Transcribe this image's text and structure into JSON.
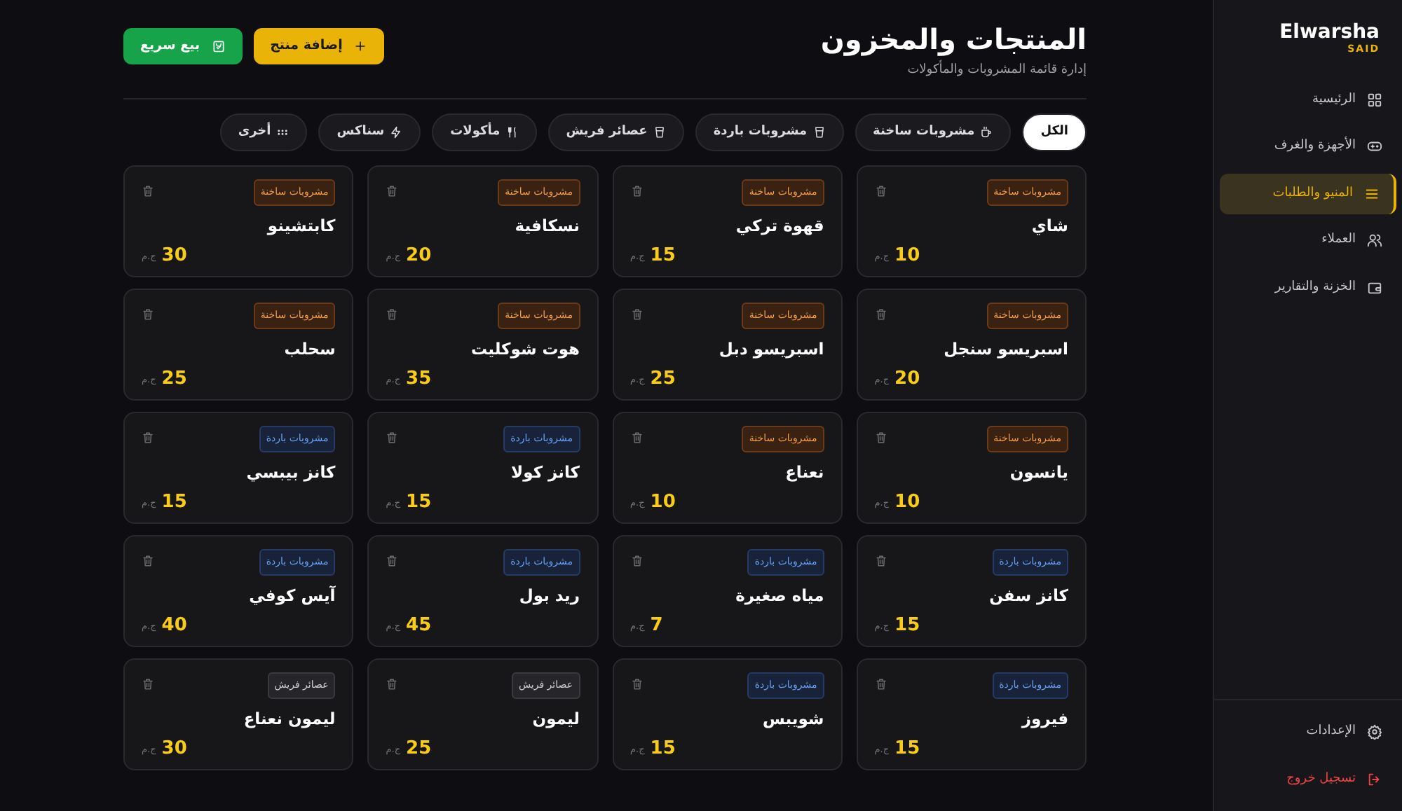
{
  "brand": {
    "name": "Elwarsha",
    "tag": "SAID"
  },
  "nav": [
    {
      "label": "الرئيسية",
      "selected": false
    },
    {
      "label": "الأجهزة والغرف",
      "selected": false
    },
    {
      "label": "المنيو والطلبات",
      "selected": true
    },
    {
      "label": "العملاء",
      "selected": false
    },
    {
      "label": "الخزنة والتقارير",
      "selected": false
    }
  ],
  "footer_nav": [
    {
      "label": "الإعدادات",
      "kind": "settings"
    },
    {
      "label": "تسجيل خروج",
      "kind": "logout"
    }
  ],
  "header": {
    "title": "المنتجات والمخزون",
    "subtitle": "إدارة قائمة المشروبات والمأكولات"
  },
  "actions": [
    {
      "label": "إضافة منتج",
      "kind": "add"
    },
    {
      "label": "بيع سريع",
      "kind": "sell"
    }
  ],
  "filters": [
    {
      "label": "الكل",
      "selected": true
    },
    {
      "label": "مشروبات ساخنة",
      "selected": false
    },
    {
      "label": "مشروبات باردة",
      "selected": false
    },
    {
      "label": "عصائر فريش",
      "selected": false
    },
    {
      "label": "مأكولات",
      "selected": false
    },
    {
      "label": "سناكس",
      "selected": false
    },
    {
      "label": "أخرى",
      "selected": false
    }
  ],
  "products": [
    {
      "name": "شاي",
      "price": "10",
      "currency": "ج.م",
      "category": "مشروبات ساخنة",
      "kind": "hot"
    },
    {
      "name": "قهوة تركي",
      "price": "15",
      "currency": "ج.م",
      "category": "مشروبات ساخنة",
      "kind": "hot"
    },
    {
      "name": "نسكافية",
      "price": "20",
      "currency": "ج.م",
      "category": "مشروبات ساخنة",
      "kind": "hot"
    },
    {
      "name": "كابتشينو",
      "price": "30",
      "currency": "ج.م",
      "category": "مشروبات ساخنة",
      "kind": "hot"
    },
    {
      "name": "اسبريسو سنجل",
      "price": "20",
      "currency": "ج.م",
      "category": "مشروبات ساخنة",
      "kind": "hot"
    },
    {
      "name": "اسبريسو دبل",
      "price": "25",
      "currency": "ج.م",
      "category": "مشروبات ساخنة",
      "kind": "hot"
    },
    {
      "name": "هوت شوكليت",
      "price": "35",
      "currency": "ج.م",
      "category": "مشروبات ساخنة",
      "kind": "hot"
    },
    {
      "name": "سحلب",
      "price": "25",
      "currency": "ج.م",
      "category": "مشروبات ساخنة",
      "kind": "hot"
    },
    {
      "name": "يانسون",
      "price": "10",
      "currency": "ج.م",
      "category": "مشروبات ساخنة",
      "kind": "hot"
    },
    {
      "name": "نعناع",
      "price": "10",
      "currency": "ج.م",
      "category": "مشروبات ساخنة",
      "kind": "hot"
    },
    {
      "name": "كانز كولا",
      "price": "15",
      "currency": "ج.م",
      "category": "مشروبات باردة",
      "kind": "cold"
    },
    {
      "name": "كانز بيبسي",
      "price": "15",
      "currency": "ج.م",
      "category": "مشروبات باردة",
      "kind": "cold"
    },
    {
      "name": "كانز سفن",
      "price": "15",
      "currency": "ج.م",
      "category": "مشروبات باردة",
      "kind": "cold"
    },
    {
      "name": "مياه صغيرة",
      "price": "7",
      "currency": "ج.م",
      "category": "مشروبات باردة",
      "kind": "cold"
    },
    {
      "name": "ريد بول",
      "price": "45",
      "currency": "ج.م",
      "category": "مشروبات باردة",
      "kind": "cold"
    },
    {
      "name": "آيس كوفي",
      "price": "40",
      "currency": "ج.م",
      "category": "مشروبات باردة",
      "kind": "cold"
    },
    {
      "name": "فيروز",
      "price": "15",
      "currency": "ج.م",
      "category": "مشروبات باردة",
      "kind": "cold"
    },
    {
      "name": "شويبس",
      "price": "15",
      "currency": "ج.م",
      "category": "مشروبات باردة",
      "kind": "cold"
    },
    {
      "name": "ليمون",
      "price": "25",
      "currency": "ج.م",
      "category": "عصائر فريش",
      "kind": "juice"
    },
    {
      "name": "ليمون نعناع",
      "price": "30",
      "currency": "ج.م",
      "category": "عصائر فريش",
      "kind": "juice"
    }
  ]
}
